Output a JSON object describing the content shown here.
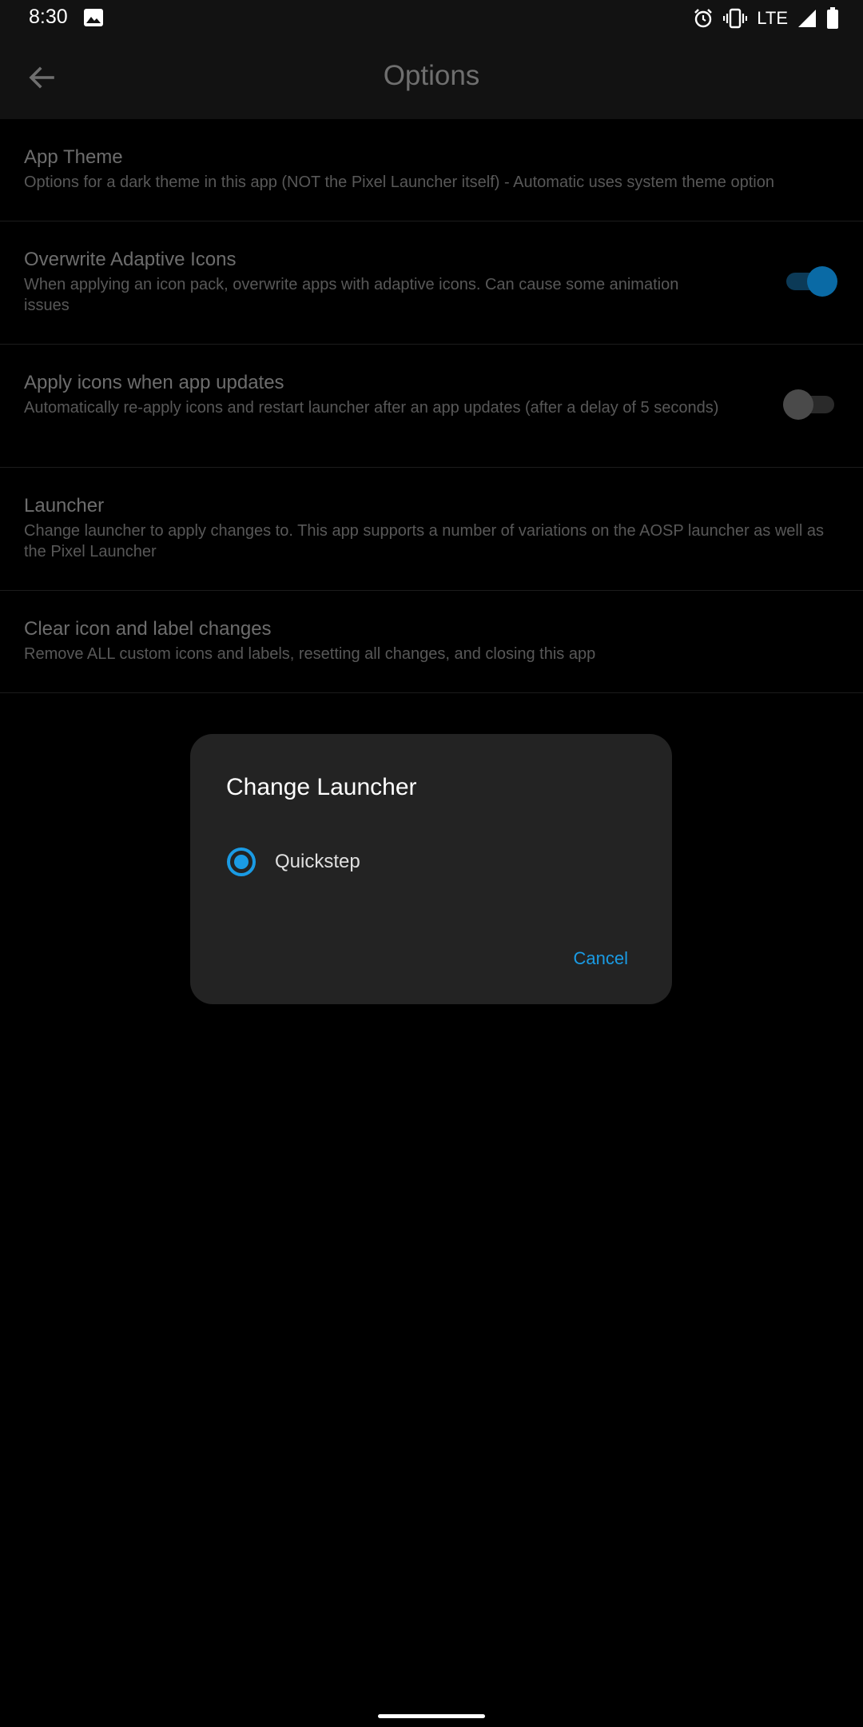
{
  "status_bar": {
    "time": "8:30",
    "network": "LTE",
    "icons": [
      "gallery-icon",
      "alarm-icon",
      "vibrate-icon",
      "signal-icon",
      "battery-icon"
    ]
  },
  "app_bar": {
    "title": "Options",
    "back_icon": "arrow-back-icon"
  },
  "settings": [
    {
      "title": "App Theme",
      "summary": "Options for a dark theme in this app (NOT the Pixel Launcher itself) - Automatic uses system theme option"
    },
    {
      "title": "Overwrite Adaptive Icons",
      "summary": "When applying an icon pack, overwrite apps with adaptive icons. Can cause some animation issues",
      "toggle": true
    },
    {
      "title": "Apply icons when app updates",
      "summary": "Automatically re-apply icons and restart launcher after an app updates (after a delay of 5 seconds)",
      "toggle": false
    },
    {
      "title": "Launcher",
      "summary": "Change launcher to apply changes to. This app supports a number of variations on the AOSP launcher as well as the Pixel Launcher"
    },
    {
      "title": "Clear icon and label changes",
      "summary": "Remove ALL custom icons and labels, resetting all changes, and closing this app"
    }
  ],
  "dialog": {
    "title": "Change Launcher",
    "options": [
      {
        "label": "Quickstep",
        "selected": true
      }
    ],
    "cancel_label": "Cancel"
  },
  "colors": {
    "accent": "#1a9be4",
    "background": "#000000",
    "appbar": "#121212",
    "dialog": "#232323"
  }
}
